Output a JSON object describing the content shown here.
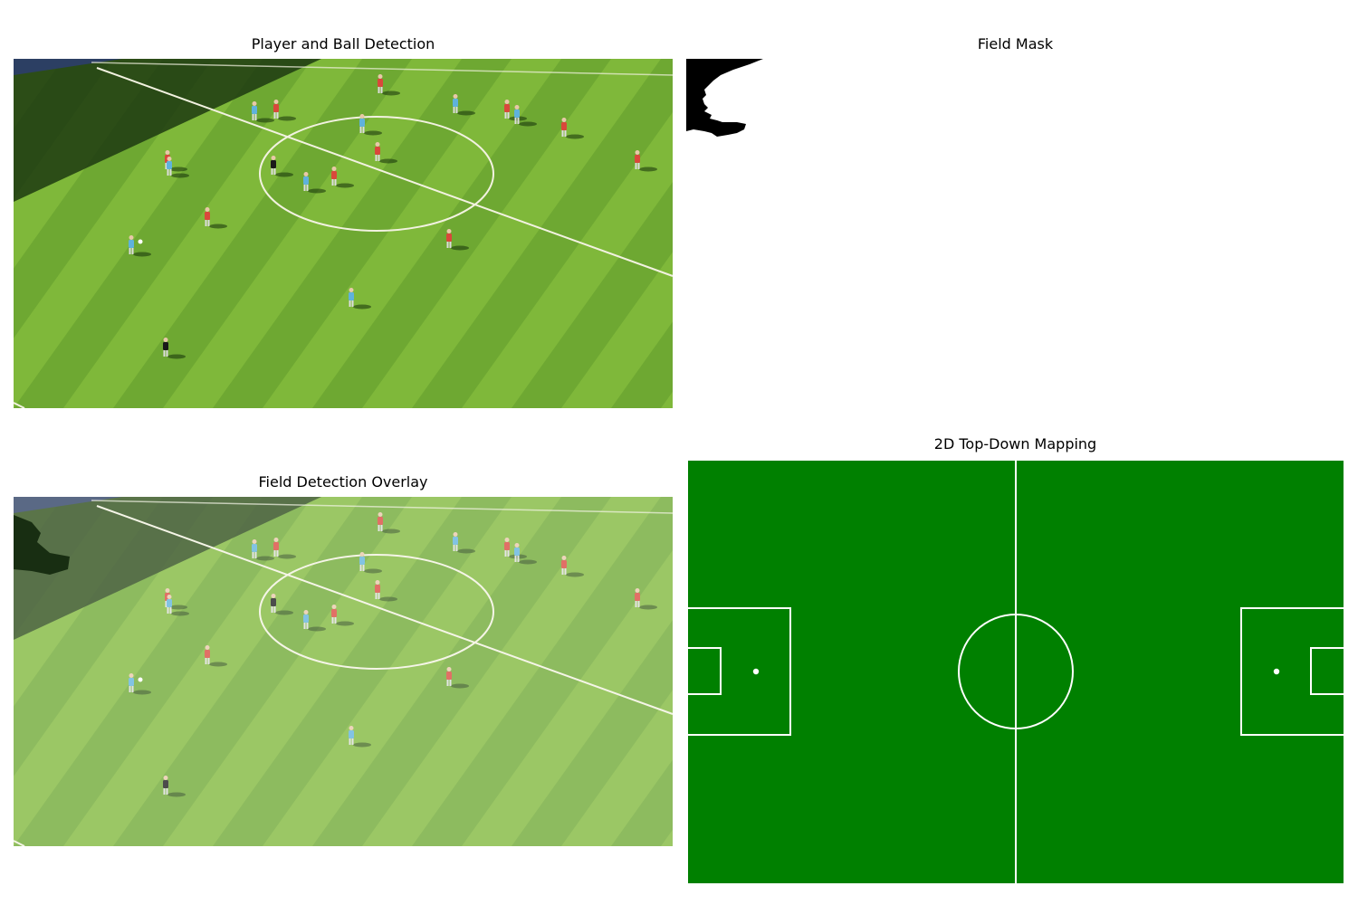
{
  "panels": {
    "detection": {
      "title": "Player and Ball Detection"
    },
    "mask": {
      "title": "Field Mask"
    },
    "overlay": {
      "title": "Field Detection Overlay"
    },
    "topdown": {
      "title": "2D Top-Down Mapping"
    }
  },
  "colors": {
    "pitch_green": "#008000",
    "grass_light": "#7fb83a",
    "grass_dark": "#4f8a24",
    "team_red": "#d9483b",
    "team_blue": "#5fb2dc",
    "referee": "#1a1a1a",
    "mask_field": "#ffffff",
    "mask_background": "#000000",
    "line_white": "#ffffff"
  }
}
